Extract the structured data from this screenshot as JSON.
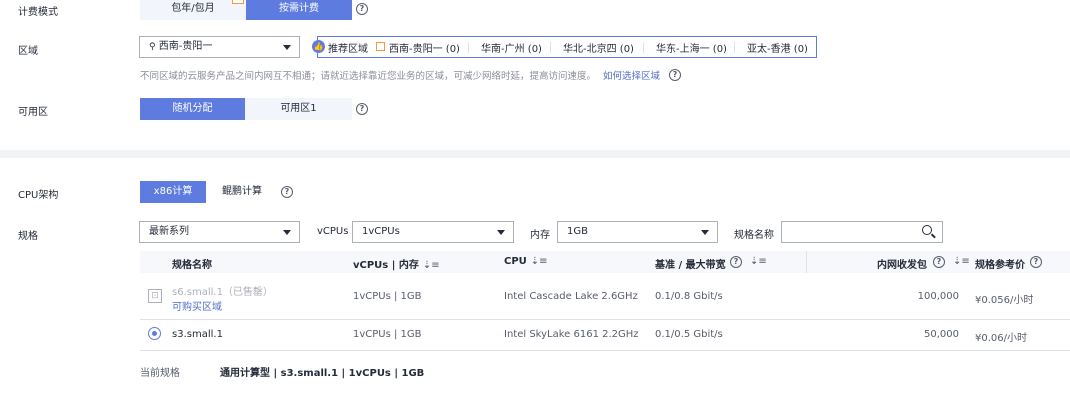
{
  "billing": {
    "label": "计费模式",
    "options": [
      "包年/包月",
      "按需计费"
    ],
    "selected": "按需计费"
  },
  "region": {
    "label": "区域",
    "selected": "西南-贵阳一",
    "recommend_label": "推荐区域",
    "recommended": [
      "西南-贵阳一 (0)",
      "华南-广州 (0)",
      "华北-北京四 (0)",
      "华东-上海一 (0)",
      "亚太-香港 (0)"
    ],
    "hint": "不同区域的云服务产品之间内网互不相通；请就近选择靠近您业务的区域，可减少网络时延，提高访问速度。",
    "hint_link": "如何选择区域"
  },
  "az": {
    "label": "可用区",
    "options": [
      "随机分配",
      "可用区1"
    ],
    "selected": "随机分配"
  },
  "cpu_arch": {
    "label": "CPU架构",
    "options": [
      "x86计算",
      "鲲鹏计算"
    ],
    "selected": "x86计算"
  },
  "spec": {
    "label": "规格",
    "series_select": "最新系列",
    "vcpus_label": "vCPUs",
    "vcpus_select": "1vCPUs",
    "memory_label": "内存",
    "memory_select": "1GB",
    "name_label": "规格名称",
    "name_placeholder": ""
  },
  "table": {
    "headers": [
      "规格名称",
      "vCPUs | 内存",
      "CPU",
      "基准 / 最大带宽",
      "内网收发包",
      "规格参考价"
    ],
    "rows": [
      {
        "name": "s6.small.1（已售罄）",
        "sub_link": "可购买区域",
        "spec": "1vCPUs | 1GB",
        "cpu": "Intel Cascade Lake 2.6GHz",
        "bandwidth": "0.1/0.8 Gbit/s",
        "pps": "100,000",
        "price": "¥0.056/小时",
        "sold_out": true
      },
      {
        "name": "s3.small.1",
        "spec": "1vCPUs | 1GB",
        "cpu": "Intel SkyLake 6161 2.2GHz",
        "bandwidth": "0.1/0.5 Gbit/s",
        "pps": "50,000",
        "price": "¥0.06/小时",
        "sold_out": false
      }
    ]
  },
  "current": {
    "label": "当前规格",
    "value": "通用计算型 | s3.small.1 | 1vCPUs | 1GB"
  },
  "colors": {
    "accent": "#5e7ce0",
    "warning": "#fa9841"
  }
}
